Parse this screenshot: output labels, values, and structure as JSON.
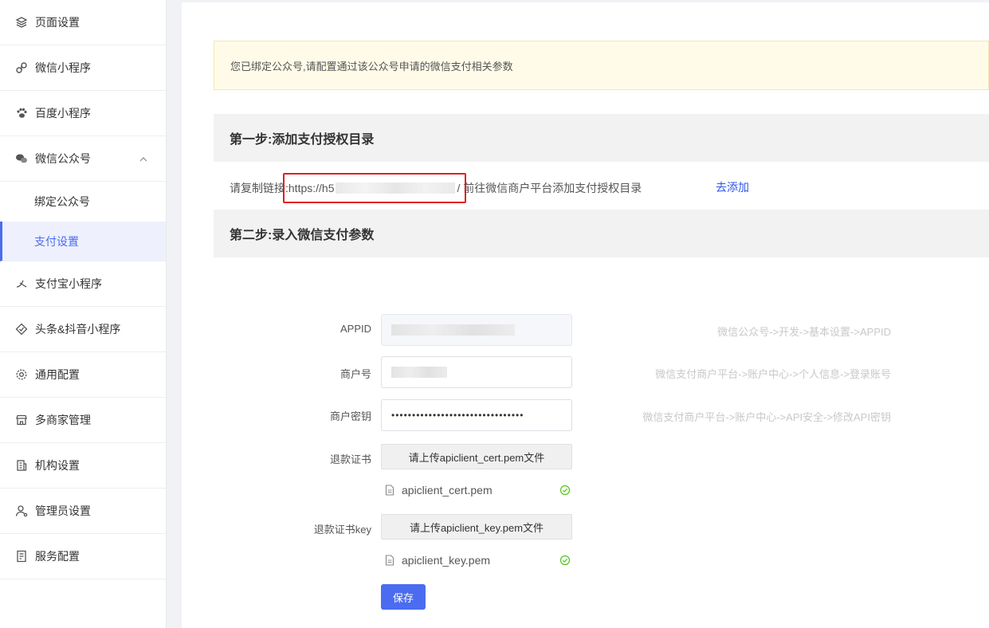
{
  "sidebar": {
    "items": [
      {
        "label": "页面设置",
        "icon": "layers-icon"
      },
      {
        "label": "微信小程序",
        "icon": "link-icon"
      },
      {
        "label": "百度小程序",
        "icon": "paw-icon"
      },
      {
        "label": "微信公众号",
        "icon": "wechat-icon",
        "expanded": true
      },
      {
        "label": "支付宝小程序",
        "icon": "alipay-icon"
      },
      {
        "label": "头条&抖音小程序",
        "icon": "toutiao-icon"
      },
      {
        "label": "通用配置",
        "icon": "gear-icon"
      },
      {
        "label": "多商家管理",
        "icon": "store-icon"
      },
      {
        "label": "机构设置",
        "icon": "building-icon"
      },
      {
        "label": "管理员设置",
        "icon": "user-icon"
      },
      {
        "label": "服务配置",
        "icon": "document-icon"
      }
    ],
    "sub_items": [
      {
        "label": "绑定公众号"
      },
      {
        "label": "支付设置",
        "active": true
      }
    ]
  },
  "main": {
    "notice": "您已绑定公众号,请配置通过该公众号申请的微信支付相关参数",
    "step1": {
      "title": "第一步:添加支付授权目录",
      "prefix": "请复制链接:",
      "url_start": "https://h5",
      "suffix": "/ 前往微信商户平台添加支付授权目录",
      "action": "去添加"
    },
    "step2": {
      "title": "第二步:录入微信支付参数"
    },
    "form": {
      "appid_label": "APPID",
      "appid_hint": "微信公众号->开发->基本设置->APPID",
      "merchant_label": "商户号",
      "merchant_hint": "微信支付商户平台->账户中心->个人信息->登录账号",
      "secret_label": "商户密钥",
      "secret_value": "••••••••••••••••••••••••••••••••",
      "secret_hint": "微信支付商户平台->账户中心->API安全->修改API密钥",
      "cert_label": "退款证书",
      "cert_button": "请上传apiclient_cert.pem文件",
      "cert_file": "apiclient_cert.pem",
      "key_label": "退款证书key",
      "key_button": "请上传apiclient_key.pem文件",
      "key_file": "apiclient_key.pem",
      "save": "保存"
    }
  },
  "colors": {
    "accent": "#4b6cf0",
    "link": "#2f54eb",
    "highlight": "#e02020",
    "success": "#52c41a"
  }
}
